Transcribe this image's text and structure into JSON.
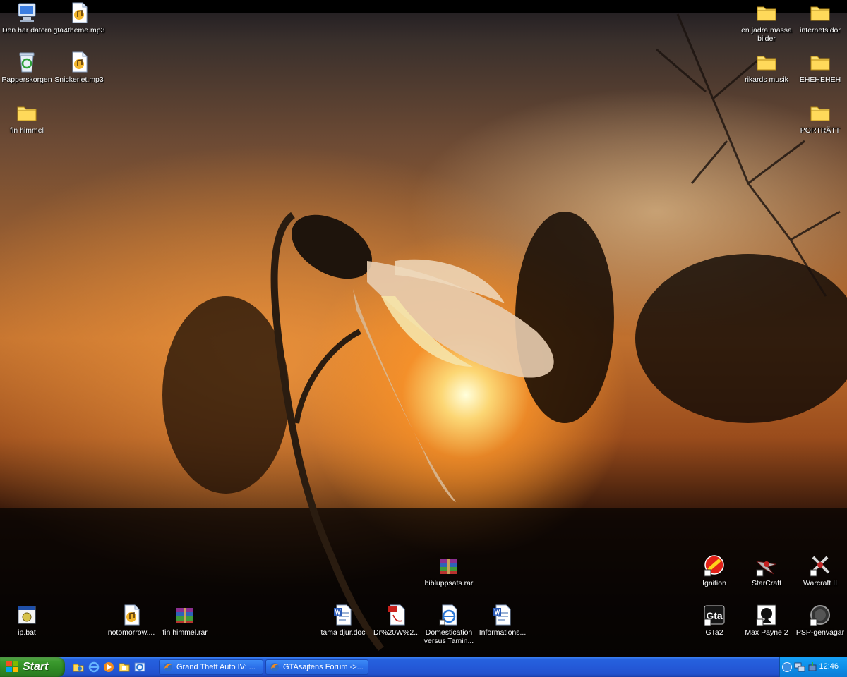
{
  "desktop": {
    "icons_left": [
      {
        "label": "Den här datorn",
        "icon": "my-computer-icon"
      },
      {
        "label": "gta4theme.mp3",
        "icon": "audio-file-icon"
      },
      {
        "label": "Papperskorgen",
        "icon": "recycle-bin-icon"
      },
      {
        "label": "Snickeriet.mp3",
        "icon": "audio-file-icon"
      },
      {
        "label": "fin himmel",
        "icon": "folder-icon"
      }
    ],
    "icons_right": [
      {
        "label": "en jädra massa bilder",
        "icon": "folder-icon"
      },
      {
        "label": "internetsidor",
        "icon": "folder-icon"
      },
      {
        "label": "rikards musik",
        "icon": "folder-icon"
      },
      {
        "label": "EHEHEHEH",
        "icon": "folder-icon"
      },
      {
        "label": "PORTRÄTT",
        "icon": "folder-icon"
      }
    ],
    "icons_bottom": [
      {
        "label": "bibluppsats.rar",
        "icon": "rar-archive-icon"
      },
      {
        "label": "ip.bat",
        "icon": "batch-file-icon"
      },
      {
        "label": "notomorrow....",
        "icon": "audio-file-icon"
      },
      {
        "label": "fin himmel.rar",
        "icon": "rar-archive-icon"
      },
      {
        "label": "tama djur.doc",
        "icon": "word-document-icon"
      },
      {
        "label": "Dr%20W%2...",
        "icon": "pdf-file-icon"
      },
      {
        "label": "Domestication versus Tamin...",
        "icon": "internet-shortcut-icon"
      },
      {
        "label": "Informations...",
        "icon": "word-document-icon"
      },
      {
        "label": "Ignition",
        "icon": "ignition-app-icon"
      },
      {
        "label": "StarCraft",
        "icon": "starcraft-app-icon"
      },
      {
        "label": "Warcraft II",
        "icon": "warcraft-app-icon"
      },
      {
        "label": "GTa2",
        "icon": "gta2-app-icon"
      },
      {
        "label": "Max Payne 2",
        "icon": "max-payne-app-icon"
      },
      {
        "label": "PSP-genvägar",
        "icon": "psp-shortcut-icon"
      }
    ]
  },
  "taskbar": {
    "start_label": "Start",
    "quick_launch": [
      "explorer-icon",
      "internet-explorer-icon",
      "media-player-icon",
      "folder-icon",
      "browser-icon"
    ],
    "windows": [
      {
        "label": "Grand Theft Auto IV: ...",
        "icon": "firefox-icon"
      },
      {
        "label": "GTAsajtens Forum ->...",
        "icon": "firefox-icon"
      }
    ],
    "tray": {
      "icons": [
        "show-hidden-icon",
        "network-icon",
        "safely-remove-icon"
      ],
      "clock": "12:46"
    }
  },
  "colors": {
    "taskbar_blue": "#2459d8",
    "start_green": "#3c9b2f",
    "tray_blue": "#0d8fe9"
  }
}
